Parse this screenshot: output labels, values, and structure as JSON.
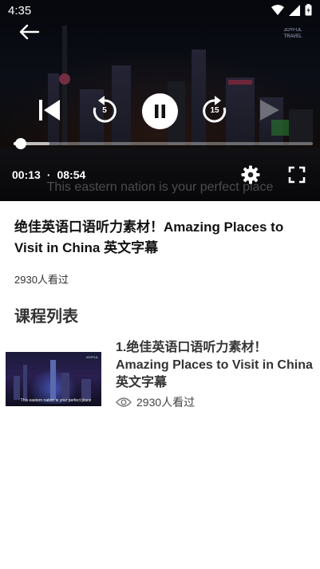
{
  "status_bar": {
    "time": "4:35"
  },
  "player": {
    "current_time": "00:13",
    "separator": "·",
    "duration": "08:54",
    "rewind_seconds": "5",
    "forward_seconds": "15",
    "progress_fraction": 0.0243,
    "buffered_fraction": 0.12,
    "subtitle": "This eastern nation is your perfect place",
    "logo_text": "JOYFUL TRAVEL"
  },
  "video": {
    "title": "绝佳英语口语听力素材！Amazing Places to Visit in China 英文字幕",
    "views": "2930人看过"
  },
  "course_list": {
    "heading": "课程列表",
    "items": [
      {
        "title": "1.绝佳英语口语听力素材！Amazing Places to Visit in China 英文字幕",
        "views": "2930人看过",
        "thumb_caption": "This eastern nation is your perfect place",
        "thumb_logo": "JOYFUL"
      }
    ]
  },
  "colors": {
    "accent": "#ffffff",
    "text_primary": "#111111",
    "text_secondary": "#333333"
  },
  "icons": {
    "back": "arrow-left-icon",
    "prev": "skip-previous-icon",
    "rewind": "replay-5-icon",
    "pause": "pause-icon",
    "forward": "forward-15-icon",
    "settings": "gear-icon",
    "fullscreen": "fullscreen-icon",
    "views": "eye-icon"
  }
}
